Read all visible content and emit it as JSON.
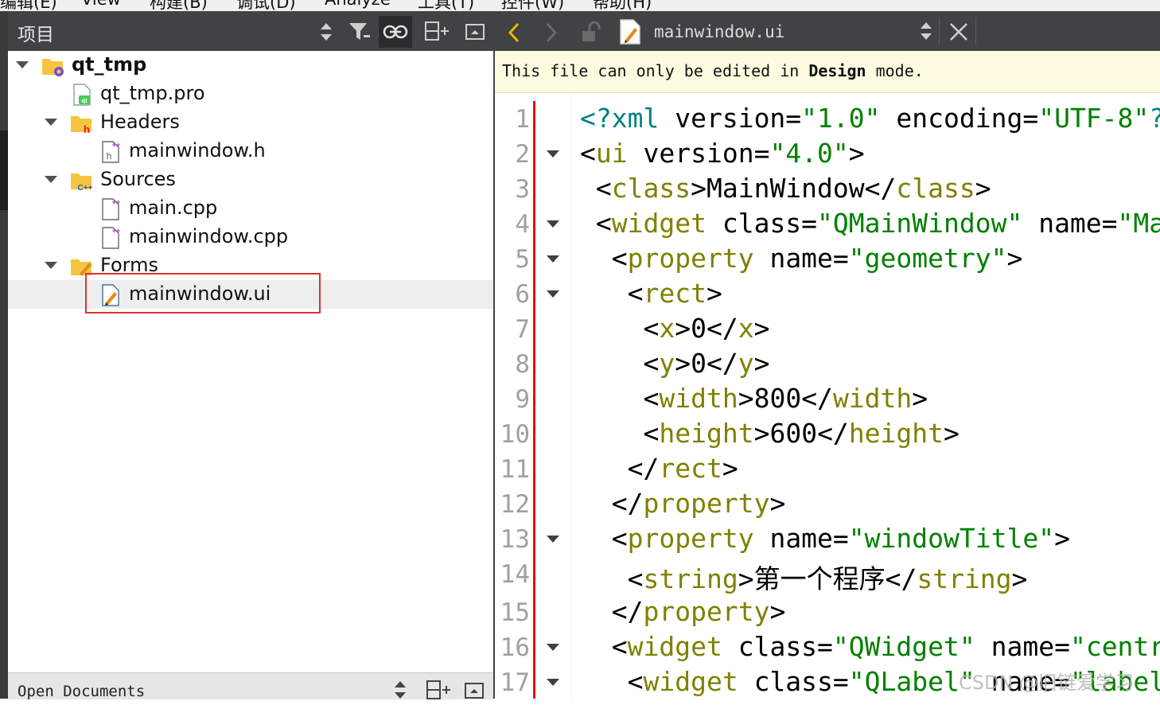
{
  "menu": [
    "编辑(E)",
    "View",
    "构建(B)",
    "调试(D)",
    "Analyze",
    "工具(T)",
    "控件(W)",
    "帮助(H)"
  ],
  "project_panel": {
    "title": "项目",
    "tools": [
      "sort-updown-icon",
      "filter-icon",
      "link-sync-icon",
      "split-add-icon",
      "close-pane-icon"
    ]
  },
  "tree": [
    {
      "label": "qt_tmp",
      "icon": "project-folder-icon",
      "level": 0,
      "expanded": true,
      "bold": true
    },
    {
      "label": "qt_tmp.pro",
      "icon": "qt-pro-file-icon",
      "level": 1
    },
    {
      "label": "Headers",
      "icon": "headers-folder-icon",
      "level": 1,
      "expanded": true
    },
    {
      "label": "mainwindow.h",
      "icon": "header-file-icon",
      "level": 2
    },
    {
      "label": "Sources",
      "icon": "sources-folder-icon",
      "level": 1,
      "expanded": true
    },
    {
      "label": "main.cpp",
      "icon": "cpp-file-icon",
      "level": 2
    },
    {
      "label": "mainwindow.cpp",
      "icon": "cpp-file-icon",
      "level": 2
    },
    {
      "label": "Forms",
      "icon": "forms-folder-icon",
      "level": 1,
      "expanded": true
    },
    {
      "label": "mainwindow.ui",
      "icon": "ui-file-icon",
      "level": 2,
      "selected": true
    }
  ],
  "open_documents": {
    "title": "Open Documents"
  },
  "editor": {
    "file_name": "mainwindow.ui",
    "info_prefix": "This file can only be edited in ",
    "info_bold": "Design",
    "info_suffix": " mode.",
    "lines": [
      {
        "n": "1",
        "fold": false,
        "tokens": [
          [
            "pi",
            "<?"
          ],
          [
            "pi",
            "xml"
          ],
          [
            "t",
            " version="
          ],
          [
            "s",
            "\"1.0\""
          ],
          [
            "t",
            " encoding="
          ],
          [
            "s",
            "\"UTF-8\""
          ],
          [
            "pi",
            "?>"
          ]
        ]
      },
      {
        "n": "2",
        "fold": true,
        "tokens": [
          [
            "p",
            "<"
          ],
          [
            "g",
            "ui"
          ],
          [
            "t",
            " version="
          ],
          [
            "s",
            "\"4.0\""
          ],
          [
            "p",
            ">"
          ]
        ]
      },
      {
        "n": "3",
        "fold": false,
        "tokens": [
          [
            "t",
            " "
          ],
          [
            "p",
            "<"
          ],
          [
            "g",
            "class"
          ],
          [
            "p",
            ">"
          ],
          [
            "t",
            "MainWindow"
          ],
          [
            "p",
            "</"
          ],
          [
            "g",
            "class"
          ],
          [
            "p",
            ">"
          ]
        ]
      },
      {
        "n": "4",
        "fold": true,
        "tokens": [
          [
            "t",
            " "
          ],
          [
            "p",
            "<"
          ],
          [
            "g",
            "widget"
          ],
          [
            "t",
            " class="
          ],
          [
            "s",
            "\"QMainWindow\""
          ],
          [
            "t",
            " name="
          ],
          [
            "s",
            "\"MainWindow\""
          ],
          [
            "p",
            ">"
          ]
        ]
      },
      {
        "n": "5",
        "fold": true,
        "tokens": [
          [
            "t",
            "  "
          ],
          [
            "p",
            "<"
          ],
          [
            "g",
            "property"
          ],
          [
            "t",
            " name="
          ],
          [
            "s",
            "\"geometry\""
          ],
          [
            "p",
            ">"
          ]
        ]
      },
      {
        "n": "6",
        "fold": true,
        "tokens": [
          [
            "t",
            "   "
          ],
          [
            "p",
            "<"
          ],
          [
            "g",
            "rect"
          ],
          [
            "p",
            ">"
          ]
        ]
      },
      {
        "n": "7",
        "fold": false,
        "tokens": [
          [
            "t",
            "    "
          ],
          [
            "p",
            "<"
          ],
          [
            "g",
            "x"
          ],
          [
            "p",
            ">"
          ],
          [
            "t",
            "0"
          ],
          [
            "p",
            "</"
          ],
          [
            "g",
            "x"
          ],
          [
            "p",
            ">"
          ]
        ]
      },
      {
        "n": "8",
        "fold": false,
        "tokens": [
          [
            "t",
            "    "
          ],
          [
            "p",
            "<"
          ],
          [
            "g",
            "y"
          ],
          [
            "p",
            ">"
          ],
          [
            "t",
            "0"
          ],
          [
            "p",
            "</"
          ],
          [
            "g",
            "y"
          ],
          [
            "p",
            ">"
          ]
        ]
      },
      {
        "n": "9",
        "fold": false,
        "tokens": [
          [
            "t",
            "    "
          ],
          [
            "p",
            "<"
          ],
          [
            "g",
            "width"
          ],
          [
            "p",
            ">"
          ],
          [
            "t",
            "800"
          ],
          [
            "p",
            "</"
          ],
          [
            "g",
            "width"
          ],
          [
            "p",
            ">"
          ]
        ]
      },
      {
        "n": "10",
        "fold": false,
        "tokens": [
          [
            "t",
            "    "
          ],
          [
            "p",
            "<"
          ],
          [
            "g",
            "height"
          ],
          [
            "p",
            ">"
          ],
          [
            "t",
            "600"
          ],
          [
            "p",
            "</"
          ],
          [
            "g",
            "height"
          ],
          [
            "p",
            ">"
          ]
        ]
      },
      {
        "n": "11",
        "fold": false,
        "tokens": [
          [
            "t",
            "   "
          ],
          [
            "p",
            "</"
          ],
          [
            "g",
            "rect"
          ],
          [
            "p",
            ">"
          ]
        ]
      },
      {
        "n": "12",
        "fold": false,
        "tokens": [
          [
            "t",
            "  "
          ],
          [
            "p",
            "</"
          ],
          [
            "g",
            "property"
          ],
          [
            "p",
            ">"
          ]
        ]
      },
      {
        "n": "13",
        "fold": true,
        "tokens": [
          [
            "t",
            "  "
          ],
          [
            "p",
            "<"
          ],
          [
            "g",
            "property"
          ],
          [
            "t",
            " name="
          ],
          [
            "s",
            "\"windowTitle\""
          ],
          [
            "p",
            ">"
          ]
        ]
      },
      {
        "n": "14",
        "fold": false,
        "tokens": [
          [
            "t",
            "   "
          ],
          [
            "p",
            "<"
          ],
          [
            "g",
            "string"
          ],
          [
            "p",
            ">"
          ],
          [
            "t",
            "第一个程序"
          ],
          [
            "p",
            "</"
          ],
          [
            "g",
            "string"
          ],
          [
            "p",
            ">"
          ]
        ]
      },
      {
        "n": "15",
        "fold": false,
        "tokens": [
          [
            "t",
            "  "
          ],
          [
            "p",
            "</"
          ],
          [
            "g",
            "property"
          ],
          [
            "p",
            ">"
          ]
        ]
      },
      {
        "n": "16",
        "fold": true,
        "tokens": [
          [
            "t",
            "  "
          ],
          [
            "p",
            "<"
          ],
          [
            "g",
            "widget"
          ],
          [
            "t",
            " class="
          ],
          [
            "s",
            "\"QWidget\""
          ],
          [
            "t",
            " name="
          ],
          [
            "s",
            "\"centralwidget\""
          ],
          [
            "p",
            ">"
          ]
        ]
      },
      {
        "n": "17",
        "fold": true,
        "tokens": [
          [
            "t",
            "   "
          ],
          [
            "p",
            "<"
          ],
          [
            "g",
            "widget"
          ],
          [
            "t",
            " class="
          ],
          [
            "s",
            "\"QLabel\""
          ],
          [
            "t",
            " name="
          ],
          [
            "s",
            "\"label\""
          ],
          [
            "p",
            ">"
          ]
        ]
      }
    ]
  },
  "watermark": "CSDN @旧链爱学习",
  "colors": {
    "toolbar": "#404244",
    "info_bg": "#fffbe0",
    "tag": "#808000",
    "string": "#008000",
    "pi": "#008080",
    "back_arrow": "#f0b400",
    "highlight": "#e03030"
  }
}
